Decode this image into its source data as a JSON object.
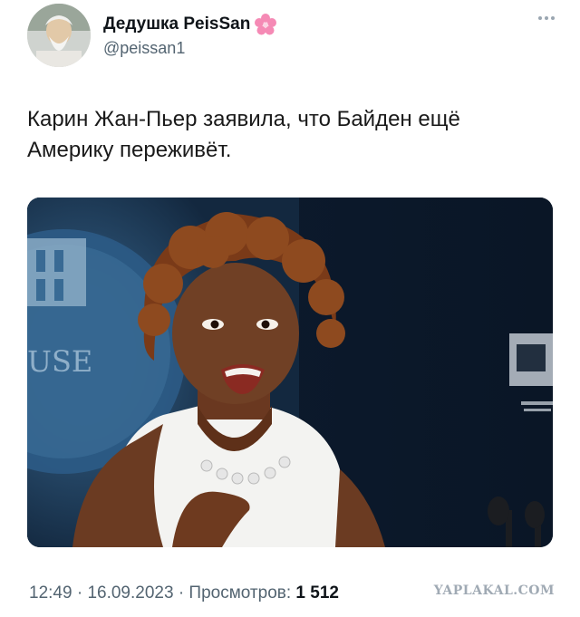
{
  "tweet": {
    "author_name": "Дедушка PeisSan",
    "author_emoji": "cherry-blossom-icon",
    "handle": "@peissan1",
    "text": "Карин Жан-Пьер заявила, что Байден ещё\nАмерику переживёт.",
    "time": "12:49",
    "date": "16.09.2023",
    "views_label": "Просмотров:",
    "views_count": "1 512",
    "separator": "·"
  },
  "media": {
    "podium_text": "USE"
  },
  "watermark": "YAPLAKAL.COM",
  "colors": {
    "text_primary": "#0f1419",
    "text_secondary": "#536471",
    "flower_pink": "#f58ab5"
  }
}
